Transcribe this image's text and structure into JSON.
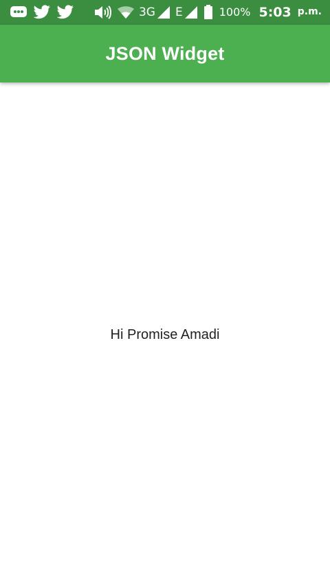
{
  "status_bar": {
    "left_icons": [
      "message-icon",
      "twitter-icon",
      "twitter-icon"
    ],
    "network_3g": "3G",
    "network_e": "E",
    "battery_percent": "100%",
    "time": "5:03",
    "ampm": "p.m."
  },
  "app_bar": {
    "title": "JSON Widget",
    "color": "#4caf50"
  },
  "main": {
    "greeting": "Hi Promise Amadi"
  },
  "colors": {
    "status_bar": "#3b8e3f",
    "app_bar": "#4caf50",
    "background": "#ffffff",
    "text": "#212121"
  }
}
